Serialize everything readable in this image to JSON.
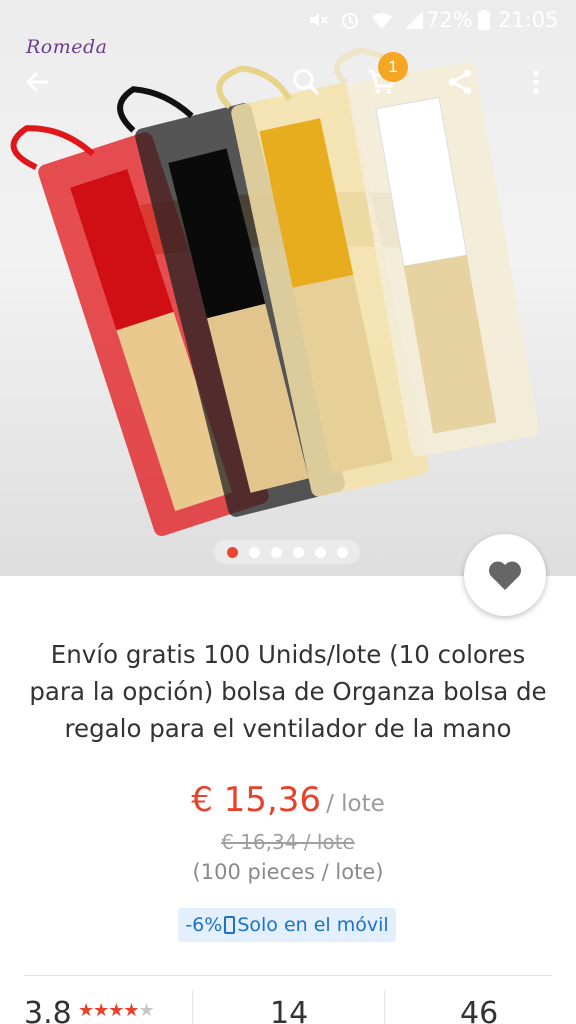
{
  "status_bar": {
    "battery": "72%",
    "time": "21:05",
    "icons": [
      "mute-icon",
      "alarm-icon",
      "wifi-icon",
      "signal-icon",
      "battery-icon"
    ]
  },
  "brand": {
    "logo_text": "Romeda"
  },
  "toolbar": {
    "icons": [
      "back-arrow-icon",
      "search-icon",
      "cart-icon",
      "share-icon",
      "more-vertical-icon"
    ],
    "cart_count": "1"
  },
  "gallery": {
    "total_images": 6,
    "active_index": 0
  },
  "product": {
    "title": "Envío gratis 100 Unids/lote (10 colores para la opción) bolsa de Organza bolsa de regalo para el ventilador de la mano",
    "price": "€ 15,36",
    "price_unit": "/ lote",
    "old_price": "€ 16,34 / lote",
    "pieces": "(100 pieces / lote)",
    "promo": {
      "discount": "-6%",
      "text": "Solo en el móvil",
      "icon": "mobile-phone-icon"
    }
  },
  "stats": {
    "rating": "3.8",
    "rating_stars": 4,
    "orders": "14",
    "wishlist": "46"
  },
  "colors": {
    "accent_red": "#e8412c",
    "badge_orange": "#f5a623",
    "promo_blue": "#1a73c8",
    "promo_bg": "#e3effc"
  }
}
